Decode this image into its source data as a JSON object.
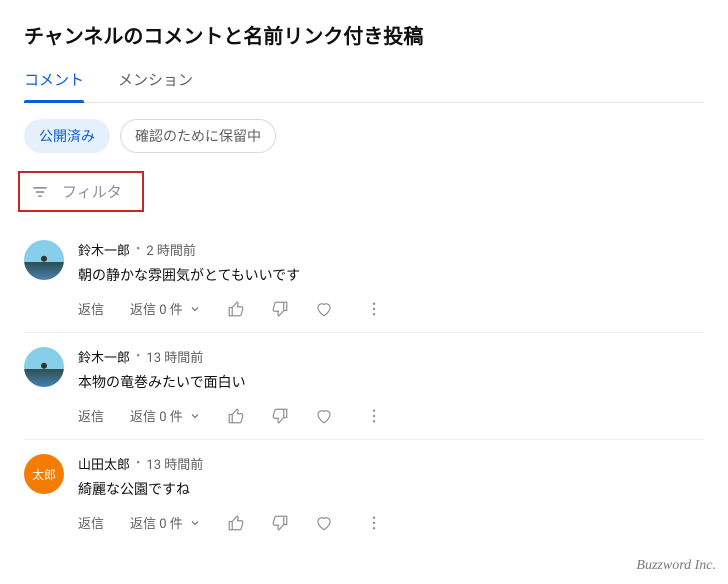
{
  "title": "チャンネルのコメントと名前リンク付き投稿",
  "tabs": {
    "comments": "コメント",
    "mentions": "メンション"
  },
  "chips": {
    "published": "公開済み",
    "held": "確認のために保留中"
  },
  "filter": {
    "label": "フィルタ"
  },
  "replyBtn": "返信",
  "repliesLabel": "返信 0 件",
  "comments": [
    {
      "author": "鈴木一郎",
      "time": "2 時間前",
      "text": "朝の静かな雰囲気がとてもいいです",
      "avatarType": "photo",
      "avatarText": ""
    },
    {
      "author": "鈴木一郎",
      "time": "13 時間前",
      "text": "本物の竜巻みたいで面白い",
      "avatarType": "photo",
      "avatarText": ""
    },
    {
      "author": "山田太郎",
      "time": "13 時間前",
      "text": "綺麗な公園ですね",
      "avatarType": "orange",
      "avatarText": "太郎"
    }
  ],
  "footer": "Buzzword Inc."
}
